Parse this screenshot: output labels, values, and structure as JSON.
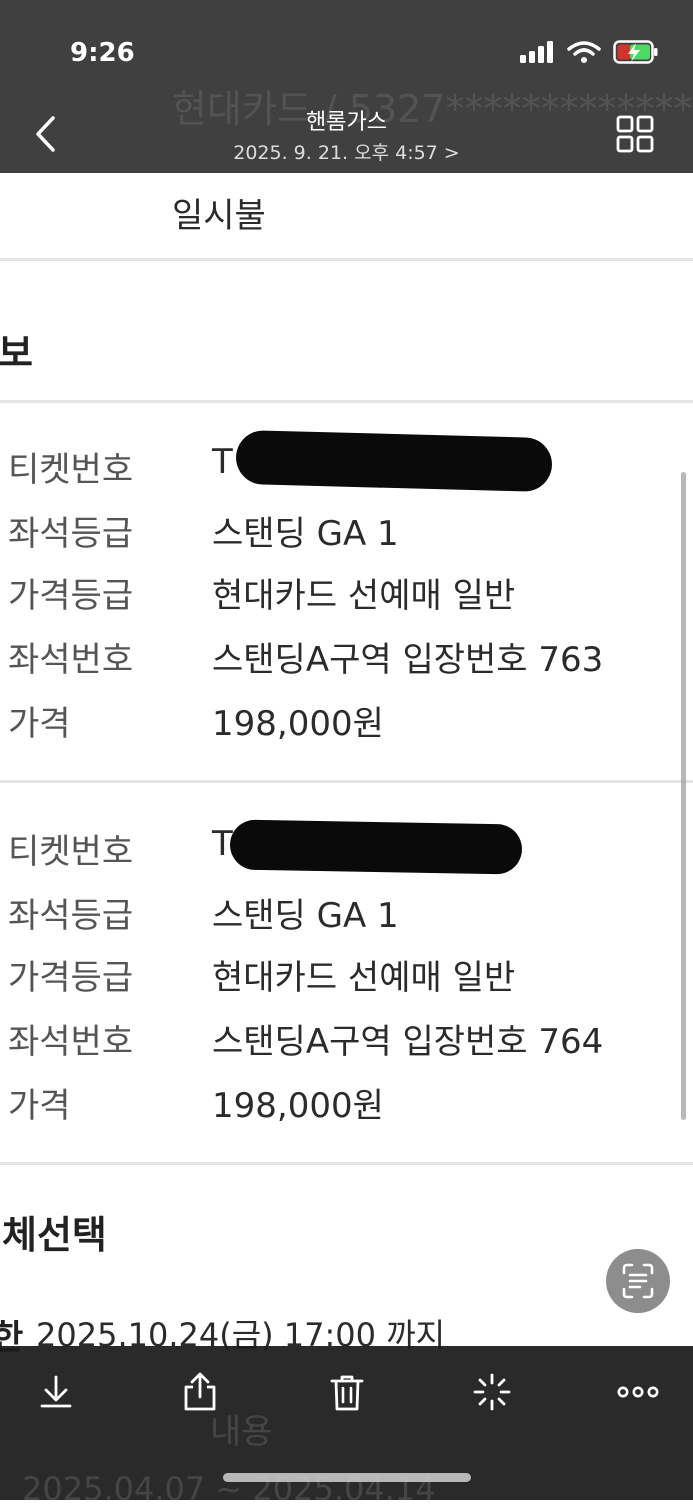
{
  "status_bar": {
    "time": "9:26"
  },
  "viewer": {
    "title": "핸롬가스",
    "subtitle": "2025. 9. 21. 오후 4:57 >",
    "behind_header_partial": "현대카드 / 5327*************"
  },
  "payment": {
    "installment": "일시불"
  },
  "section_title_partial": "보",
  "tickets": [
    {
      "ticket_label": "티켓번호",
      "ticket_value": "T",
      "seat_grade_label": "좌석등급",
      "seat_grade": "스탠딩 GA 1",
      "price_grade_label": "가격등급",
      "price_grade": "현대카드 선예매 일반",
      "seat_no_label": "좌석번호",
      "seat_no": "스탠딩A구역 입장번호 763",
      "price_label": "가격",
      "price": "198,000원"
    },
    {
      "ticket_label": "티켓번호",
      "ticket_value": "T",
      "seat_grade_label": "좌석등급",
      "seat_grade": "스탠딩 GA 1",
      "price_grade_label": "가격등급",
      "price_grade": "현대카드 선예매 일반",
      "seat_no_label": "좌석번호",
      "seat_no": "스탠딩A구역 입장번호 764",
      "price_label": "가격",
      "price": "198,000원"
    }
  ],
  "delivery_section_title_partial": "체선택",
  "deadline": {
    "prefix_partial": "한",
    "text": "2025.10.24(금) 17:00 까지"
  },
  "behind_toolbar": {
    "content_label": "내용",
    "date_partial": "2025.04.07 ~ 2025.04.14"
  },
  "icons": {
    "back": "chevron-left-icon",
    "grid": "grid-icon",
    "download": "download-icon",
    "share": "share-icon",
    "delete": "trash-icon",
    "enhance": "sparkle-icon",
    "more": "more-icon",
    "ocr": "text-scan-icon"
  },
  "colors": {
    "chrome_bg": "#161616",
    "battery_green": "#4cd964",
    "battery_red": "#d0342c"
  }
}
